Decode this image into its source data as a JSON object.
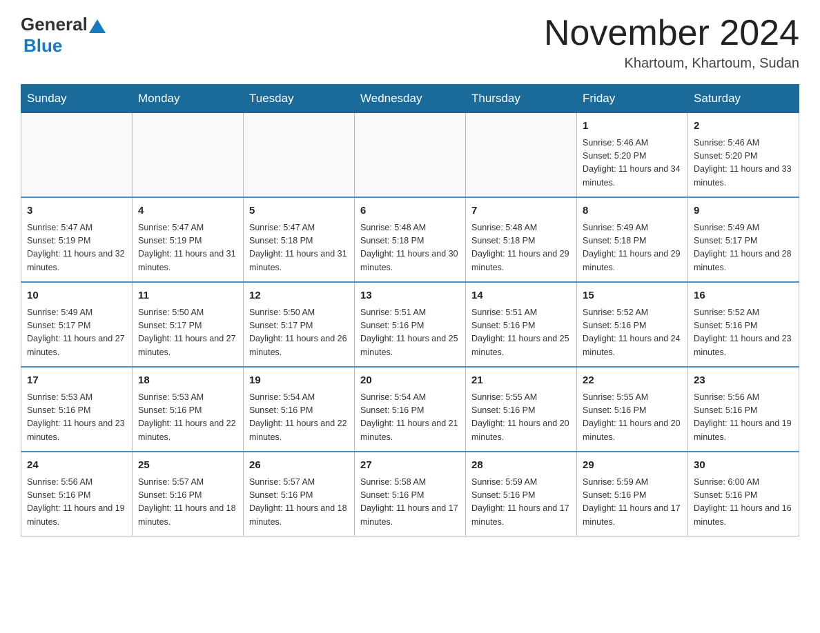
{
  "logo": {
    "general": "General",
    "blue": "Blue"
  },
  "header": {
    "title": "November 2024",
    "subtitle": "Khartoum, Khartoum, Sudan"
  },
  "weekdays": [
    "Sunday",
    "Monday",
    "Tuesday",
    "Wednesday",
    "Thursday",
    "Friday",
    "Saturday"
  ],
  "weeks": [
    [
      {
        "day": "",
        "info": ""
      },
      {
        "day": "",
        "info": ""
      },
      {
        "day": "",
        "info": ""
      },
      {
        "day": "",
        "info": ""
      },
      {
        "day": "",
        "info": ""
      },
      {
        "day": "1",
        "info": "Sunrise: 5:46 AM\nSunset: 5:20 PM\nDaylight: 11 hours and 34 minutes."
      },
      {
        "day": "2",
        "info": "Sunrise: 5:46 AM\nSunset: 5:20 PM\nDaylight: 11 hours and 33 minutes."
      }
    ],
    [
      {
        "day": "3",
        "info": "Sunrise: 5:47 AM\nSunset: 5:19 PM\nDaylight: 11 hours and 32 minutes."
      },
      {
        "day": "4",
        "info": "Sunrise: 5:47 AM\nSunset: 5:19 PM\nDaylight: 11 hours and 31 minutes."
      },
      {
        "day": "5",
        "info": "Sunrise: 5:47 AM\nSunset: 5:18 PM\nDaylight: 11 hours and 31 minutes."
      },
      {
        "day": "6",
        "info": "Sunrise: 5:48 AM\nSunset: 5:18 PM\nDaylight: 11 hours and 30 minutes."
      },
      {
        "day": "7",
        "info": "Sunrise: 5:48 AM\nSunset: 5:18 PM\nDaylight: 11 hours and 29 minutes."
      },
      {
        "day": "8",
        "info": "Sunrise: 5:49 AM\nSunset: 5:18 PM\nDaylight: 11 hours and 29 minutes."
      },
      {
        "day": "9",
        "info": "Sunrise: 5:49 AM\nSunset: 5:17 PM\nDaylight: 11 hours and 28 minutes."
      }
    ],
    [
      {
        "day": "10",
        "info": "Sunrise: 5:49 AM\nSunset: 5:17 PM\nDaylight: 11 hours and 27 minutes."
      },
      {
        "day": "11",
        "info": "Sunrise: 5:50 AM\nSunset: 5:17 PM\nDaylight: 11 hours and 27 minutes."
      },
      {
        "day": "12",
        "info": "Sunrise: 5:50 AM\nSunset: 5:17 PM\nDaylight: 11 hours and 26 minutes."
      },
      {
        "day": "13",
        "info": "Sunrise: 5:51 AM\nSunset: 5:16 PM\nDaylight: 11 hours and 25 minutes."
      },
      {
        "day": "14",
        "info": "Sunrise: 5:51 AM\nSunset: 5:16 PM\nDaylight: 11 hours and 25 minutes."
      },
      {
        "day": "15",
        "info": "Sunrise: 5:52 AM\nSunset: 5:16 PM\nDaylight: 11 hours and 24 minutes."
      },
      {
        "day": "16",
        "info": "Sunrise: 5:52 AM\nSunset: 5:16 PM\nDaylight: 11 hours and 23 minutes."
      }
    ],
    [
      {
        "day": "17",
        "info": "Sunrise: 5:53 AM\nSunset: 5:16 PM\nDaylight: 11 hours and 23 minutes."
      },
      {
        "day": "18",
        "info": "Sunrise: 5:53 AM\nSunset: 5:16 PM\nDaylight: 11 hours and 22 minutes."
      },
      {
        "day": "19",
        "info": "Sunrise: 5:54 AM\nSunset: 5:16 PM\nDaylight: 11 hours and 22 minutes."
      },
      {
        "day": "20",
        "info": "Sunrise: 5:54 AM\nSunset: 5:16 PM\nDaylight: 11 hours and 21 minutes."
      },
      {
        "day": "21",
        "info": "Sunrise: 5:55 AM\nSunset: 5:16 PM\nDaylight: 11 hours and 20 minutes."
      },
      {
        "day": "22",
        "info": "Sunrise: 5:55 AM\nSunset: 5:16 PM\nDaylight: 11 hours and 20 minutes."
      },
      {
        "day": "23",
        "info": "Sunrise: 5:56 AM\nSunset: 5:16 PM\nDaylight: 11 hours and 19 minutes."
      }
    ],
    [
      {
        "day": "24",
        "info": "Sunrise: 5:56 AM\nSunset: 5:16 PM\nDaylight: 11 hours and 19 minutes."
      },
      {
        "day": "25",
        "info": "Sunrise: 5:57 AM\nSunset: 5:16 PM\nDaylight: 11 hours and 18 minutes."
      },
      {
        "day": "26",
        "info": "Sunrise: 5:57 AM\nSunset: 5:16 PM\nDaylight: 11 hours and 18 minutes."
      },
      {
        "day": "27",
        "info": "Sunrise: 5:58 AM\nSunset: 5:16 PM\nDaylight: 11 hours and 17 minutes."
      },
      {
        "day": "28",
        "info": "Sunrise: 5:59 AM\nSunset: 5:16 PM\nDaylight: 11 hours and 17 minutes."
      },
      {
        "day": "29",
        "info": "Sunrise: 5:59 AM\nSunset: 5:16 PM\nDaylight: 11 hours and 17 minutes."
      },
      {
        "day": "30",
        "info": "Sunrise: 6:00 AM\nSunset: 5:16 PM\nDaylight: 11 hours and 16 minutes."
      }
    ]
  ]
}
